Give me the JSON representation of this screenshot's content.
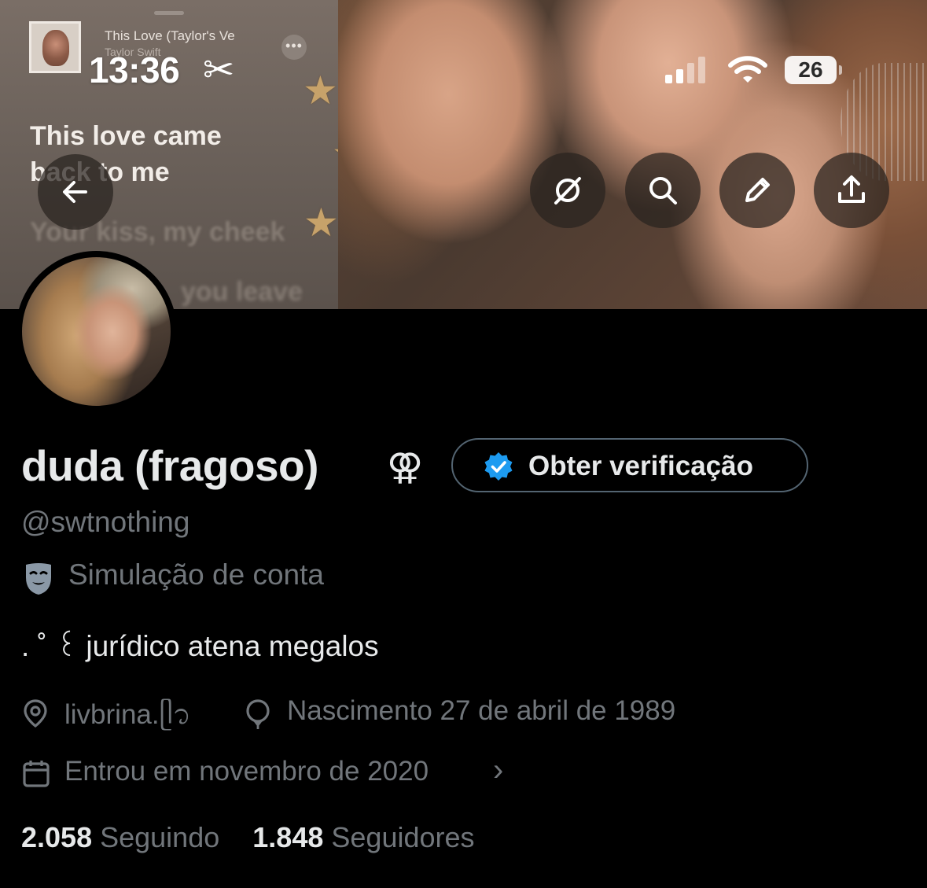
{
  "status_bar": {
    "time": "13:36",
    "battery": "26"
  },
  "now_playing": {
    "title": "This Love (Taylor's Ve",
    "artist": "Taylor Swift"
  },
  "lyrics": {
    "line1": "This love came",
    "line2": "back to me",
    "line3": "Your kiss, my cheek",
    "line4": "you leave"
  },
  "profile": {
    "display_name": "duda (fragoso)",
    "name_symbol": "⚢",
    "verify_button_label": "Obter verificação",
    "handle": "@swtnothing",
    "parody_label": "Simulação de conta",
    "bio": ". ˚ ꒰ jurídico atena megalos",
    "location": "livbrina.ᥫ᭡",
    "birthday": "Nascimento 27 de abril de 1989",
    "joined": "Entrou em novembro de 2020",
    "following_count": "2.058",
    "following_label": "Seguindo",
    "followers_count": "1.848",
    "followers_label": "Seguidores"
  },
  "icons": {
    "back": "arrow-left-icon",
    "grok": "grok-icon",
    "search": "search-icon",
    "edit": "pencil-icon",
    "share": "share-icon",
    "verified": "verified-badge-icon",
    "parody": "theater-mask-icon",
    "location": "location-pin-icon",
    "birthday": "balloon-icon",
    "calendar": "calendar-icon"
  },
  "colors": {
    "accent": "#1d9bf0",
    "muted_text": "#71767b",
    "primary_text": "#e7e9ea",
    "background": "#000000"
  }
}
